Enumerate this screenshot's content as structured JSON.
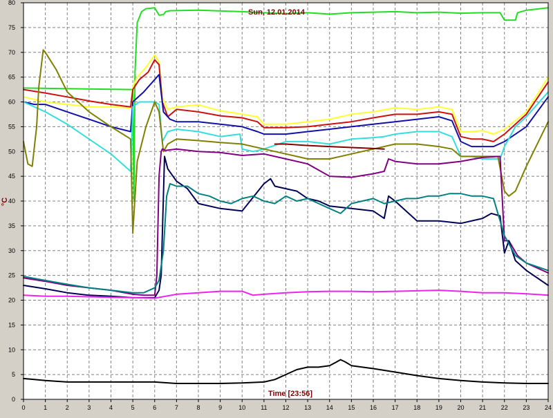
{
  "chart_data": {
    "type": "line",
    "title": "Sun, 12.01.2014",
    "xlabel": "Time [23:56]",
    "ylabel": "°C",
    "xlim": [
      0,
      24
    ],
    "ylim": [
      0,
      80
    ],
    "x_ticks": [
      0,
      1,
      2,
      3,
      4,
      5,
      6,
      7,
      8,
      9,
      10,
      11,
      12,
      13,
      14,
      15,
      16,
      17,
      18,
      19,
      20,
      21,
      22,
      23,
      24
    ],
    "y_ticks": [
      0,
      5,
      10,
      15,
      20,
      25,
      30,
      35,
      40,
      45,
      50,
      55,
      60,
      65,
      70,
      75,
      80
    ],
    "grid": true,
    "colors": {
      "title": "#800000",
      "xlabel": "#800000",
      "ylabel": "#800000",
      "grid": "#808080",
      "plot_bg": "#ffffff",
      "frame_bg": "#d4d0c8"
    },
    "series": [
      {
        "color": "#22dd22",
        "x": [
          0,
          5,
          5.05,
          5.1,
          5.2,
          5.4,
          5.6,
          6,
          6.2,
          6.4,
          6.5,
          6.7,
          8,
          10,
          11,
          12,
          13,
          14,
          15,
          16,
          17,
          18,
          19,
          20,
          21,
          21.8,
          22,
          22.5,
          22.6,
          23,
          24
        ],
        "y": [
          62.8,
          62.5,
          40,
          66,
          76,
          78.2,
          78.8,
          79,
          77.5,
          77.6,
          78.2,
          78.4,
          78.5,
          78.2,
          78,
          77.8,
          78,
          77.7,
          78,
          78.1,
          78.2,
          78,
          78.1,
          77.9,
          78,
          78,
          76.5,
          76.5,
          78,
          78.5,
          79
        ]
      },
      {
        "color": "#ffff33",
        "x": [
          0,
          0.5,
          1,
          2,
          3,
          4,
          4.9,
          5,
          5.2,
          5.6,
          6,
          6.2,
          6.35,
          6.6,
          7,
          8,
          9,
          10,
          10.7,
          11,
          12,
          13,
          14,
          15,
          16,
          17,
          18,
          19,
          19.6,
          20,
          20.5,
          21,
          21.5,
          22,
          23,
          24
        ],
        "y": [
          61,
          60.5,
          60,
          59.5,
          59,
          59,
          58.8,
          63,
          65,
          67,
          69.5,
          68,
          61,
          58.5,
          59,
          59.4,
          58.2,
          57.5,
          57,
          55.5,
          55.5,
          56,
          56.5,
          57.5,
          58,
          58.8,
          58.5,
          59,
          58.5,
          54,
          54,
          54.2,
          53.5,
          54.5,
          58,
          65
        ]
      },
      {
        "color": "#cc1111",
        "x": [
          0,
          1,
          2,
          3,
          4,
          4.9,
          5,
          5.3,
          5.7,
          6,
          6.2,
          6.35,
          6.6,
          7,
          8,
          9,
          10,
          10.7,
          11,
          12,
          13,
          14,
          15,
          16,
          17,
          18,
          19,
          19.6,
          20,
          20.5,
          21,
          21.5,
          22,
          23,
          24
        ],
        "y": [
          62.5,
          61.8,
          61,
          60.2,
          59.5,
          59,
          62.5,
          64.5,
          66,
          68.5,
          67.5,
          60,
          57,
          58.5,
          58,
          57.2,
          56.8,
          56,
          54.8,
          54.8,
          55,
          55.5,
          56,
          56.8,
          57.5,
          57.5,
          58,
          57.5,
          53,
          52.5,
          52.5,
          52,
          53.5,
          57.5,
          64
        ]
      },
      {
        "color": "#1111aa",
        "x": [
          0,
          0.5,
          1,
          2,
          3,
          4,
          4.9,
          5,
          5.5,
          6,
          6.2,
          6.4,
          6.7,
          7,
          8,
          9,
          10,
          10.7,
          11,
          12,
          13,
          14,
          15,
          16,
          17,
          18,
          19,
          19.6,
          20,
          20.5,
          21,
          21.5,
          22,
          23,
          24
        ],
        "y": [
          60,
          59.5,
          59.5,
          58,
          56.5,
          55,
          54,
          60,
          62,
          64.5,
          65.5,
          58,
          56.5,
          56,
          56,
          55.5,
          55,
          54,
          53.5,
          53.5,
          54,
          54.5,
          55,
          55.5,
          56,
          56.5,
          57,
          56.2,
          52,
          51,
          51,
          51,
          52,
          55,
          61
        ]
      },
      {
        "color": "#33dddd",
        "x": [
          0,
          1,
          2,
          3,
          4,
          4.9,
          5,
          5.3,
          6,
          6.2,
          6.35,
          6.6,
          7,
          8,
          9,
          9.9,
          10,
          10.5,
          11,
          12,
          13,
          14,
          15,
          16,
          16.5,
          17,
          18,
          19,
          19.6,
          20,
          20.5,
          21,
          21.8,
          22,
          22.5,
          23,
          24
        ],
        "y": [
          60,
          58,
          55.5,
          52.5,
          49.5,
          46,
          59,
          60,
          60,
          59.5,
          52,
          54,
          54.5,
          54,
          53,
          53.5,
          50.5,
          50,
          50.5,
          52,
          52,
          51.5,
          52.5,
          52.8,
          53,
          53.5,
          54,
          54,
          53,
          49,
          49,
          48.5,
          48.5,
          51,
          55,
          57,
          62
        ]
      },
      {
        "color": "#808000",
        "x": [
          0,
          0.2,
          0.4,
          0.6,
          0.7,
          0.9,
          1,
          1.5,
          2,
          3,
          4,
          4.8,
          4.9,
          5,
          5.2,
          5.6,
          6,
          6.2,
          6.4,
          6.6,
          7,
          8,
          9,
          10,
          11,
          12,
          12.5,
          13,
          14,
          15,
          16,
          17,
          18,
          19,
          19.6,
          20,
          21,
          21.7,
          22,
          22.2,
          22.5,
          23,
          24
        ],
        "y": [
          52,
          47.5,
          47,
          55,
          63,
          70.5,
          70,
          66.5,
          62,
          58,
          55,
          52.8,
          52.5,
          33.5,
          48,
          55,
          60,
          58,
          50,
          51.5,
          52.5,
          52.2,
          51.8,
          51.5,
          50.5,
          49.5,
          49,
          48.5,
          48.5,
          49.5,
          50.5,
          51.5,
          51.5,
          51,
          50.5,
          49,
          49,
          49,
          42,
          41,
          42,
          47,
          56
        ]
      },
      {
        "color": "#800000",
        "x": [
          11.5,
          12,
          13,
          14,
          15,
          16,
          16.5
        ],
        "y": [
          51.5,
          51.5,
          51.2,
          51,
          50.8,
          50.6,
          50.5
        ]
      },
      {
        "color": "#800080",
        "x": [
          0,
          1,
          2,
          3,
          4,
          5,
          5.5,
          6,
          6.1,
          6.2,
          6.3,
          6.35,
          6.5,
          7,
          8,
          9,
          10,
          11,
          12,
          13,
          14,
          15,
          16,
          16.5,
          16.7,
          17,
          18,
          19,
          20,
          21,
          21.8,
          22,
          22.2,
          22.6,
          23,
          24
        ],
        "y": [
          24.5,
          23.8,
          23,
          22.5,
          22,
          21.2,
          21,
          21,
          25,
          45,
          50,
          50.5,
          50.2,
          50.5,
          50,
          49.8,
          49.2,
          49.5,
          48.5,
          47.5,
          45,
          44.8,
          45.5,
          46,
          48.5,
          48,
          47.5,
          47.5,
          48,
          48.8,
          49,
          32,
          32,
          29,
          27.5,
          25.5
        ]
      },
      {
        "color": "#000055",
        "x": [
          0,
          1,
          2,
          3,
          4,
          5,
          5.5,
          6,
          6.2,
          6.3,
          6.45,
          6.6,
          7,
          7.5,
          8,
          9,
          10,
          11,
          11.3,
          11.5,
          12,
          12.5,
          13,
          13.5,
          14,
          15,
          16,
          16.5,
          16.7,
          17,
          17.5,
          18,
          19,
          20,
          21,
          21.4,
          21.8,
          22,
          22.2,
          22.5,
          23,
          24
        ],
        "y": [
          23,
          22.3,
          21.5,
          21,
          20.8,
          20.5,
          20.5,
          20.5,
          22,
          25,
          49,
          46.5,
          44,
          42.5,
          39.5,
          38.5,
          38,
          43.5,
          44.5,
          43,
          42.5,
          42,
          40.5,
          40,
          39,
          38.5,
          38,
          36.5,
          41,
          40,
          38,
          36,
          36,
          35.5,
          36.5,
          37.5,
          37,
          29.5,
          32,
          28,
          26,
          23
        ]
      },
      {
        "color": "#008080",
        "x": [
          0,
          1,
          2,
          3,
          4,
          5,
          5.5,
          6,
          6.2,
          6.4,
          6.55,
          6.7,
          7,
          7.5,
          8,
          8.5,
          9,
          9.5,
          10,
          10.5,
          11,
          11.5,
          12,
          12.5,
          13,
          13.5,
          14,
          14.5,
          15,
          15.5,
          16,
          16.5,
          17,
          17.5,
          18,
          18.5,
          19,
          19.5,
          20,
          20.5,
          21,
          21.5,
          22,
          22.5,
          23,
          24
        ],
        "y": [
          24.8,
          24,
          23.2,
          22.5,
          22,
          21.5,
          21.5,
          22.5,
          24,
          30,
          41,
          43.5,
          43,
          43,
          41.5,
          41,
          40,
          39.5,
          40.5,
          41,
          40,
          39.5,
          41,
          40,
          40.5,
          39.5,
          38.5,
          37.5,
          39.5,
          40,
          40.5,
          39.5,
          40,
          40.5,
          40.5,
          41,
          41,
          41.5,
          41.5,
          41,
          41,
          40.5,
          33,
          29,
          27.5,
          26
        ]
      },
      {
        "color": "#ee22ee",
        "x": [
          0,
          1,
          2,
          3,
          4,
          5,
          6,
          7,
          8,
          9,
          10,
          10.5,
          11,
          12,
          13,
          14,
          15,
          16,
          17,
          18,
          19,
          20,
          21,
          22,
          23,
          24
        ],
        "y": [
          21,
          20.8,
          20.8,
          20.7,
          20.6,
          20.5,
          20.4,
          21.2,
          21.5,
          21.8,
          21.8,
          21,
          21.2,
          21.5,
          21.7,
          21.8,
          21.8,
          21.7,
          21.8,
          21.9,
          22,
          21.8,
          21.5,
          21.5,
          21.3,
          21
        ]
      },
      {
        "color": "#000000",
        "x": [
          0,
          0.5,
          1,
          2,
          3,
          4,
          5,
          6,
          7,
          8,
          9,
          10,
          11,
          11.5,
          12,
          12.5,
          13,
          13.5,
          14,
          14.3,
          14.5,
          14.7,
          15,
          16,
          17,
          18,
          19,
          20,
          21,
          22,
          23,
          24
        ],
        "y": [
          4.2,
          4,
          3.8,
          3.5,
          3.5,
          3.5,
          3.5,
          3.5,
          3.2,
          3.2,
          3.2,
          3.3,
          3.5,
          4,
          5,
          6,
          6.5,
          6.5,
          6.8,
          7.5,
          8,
          7.6,
          6.8,
          6.2,
          5.5,
          4.8,
          4.2,
          3.8,
          3.5,
          3.3,
          3.2,
          3.2
        ]
      }
    ]
  }
}
